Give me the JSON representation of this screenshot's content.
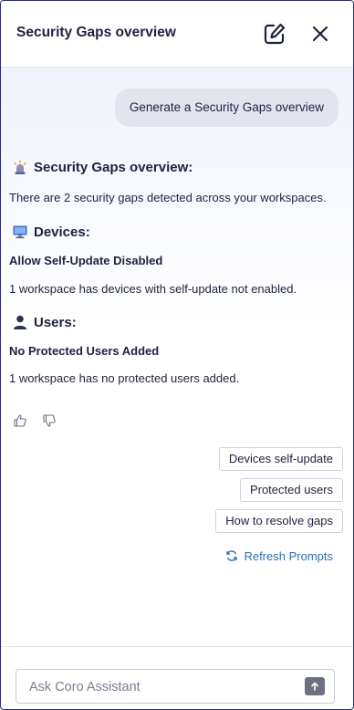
{
  "header": {
    "title": "Security Gaps overview",
    "edit_icon": "edit-icon",
    "close_icon": "close-icon"
  },
  "conversation": {
    "user_message": "Generate a Security Gaps overview",
    "response": {
      "heading_icon": "alarm-icon",
      "heading": "Security Gaps overview:",
      "summary": "There are 2 security gaps detected across your workspaces.",
      "sections": [
        {
          "icon": "computer-icon",
          "title": "Devices:",
          "item_title": "Allow Self-Update Disabled",
          "item_text": "1 workspace has devices with self-update not enabled."
        },
        {
          "icon": "user-icon",
          "title": "Users:",
          "item_title": "No Protected Users Added",
          "item_text": "1 workspace has no protected users added."
        }
      ]
    },
    "feedback": {
      "like_icon": "thumbs-up-icon",
      "dislike_icon": "thumbs-down-icon"
    }
  },
  "suggestions": {
    "chips": [
      "Devices self-update",
      "Protected users",
      "How to resolve gaps"
    ],
    "refresh_label": "Refresh Prompts",
    "refresh_icon": "refresh-icon"
  },
  "composer": {
    "placeholder": "Ask Coro Assistant",
    "send_icon": "arrow-up-icon"
  },
  "colors": {
    "title_text": "#1e2140",
    "link": "#2f6fb0",
    "bubble_bg": "#e3e5ee",
    "send_button": "#6c7081",
    "frame_border": "#2d2f66"
  }
}
